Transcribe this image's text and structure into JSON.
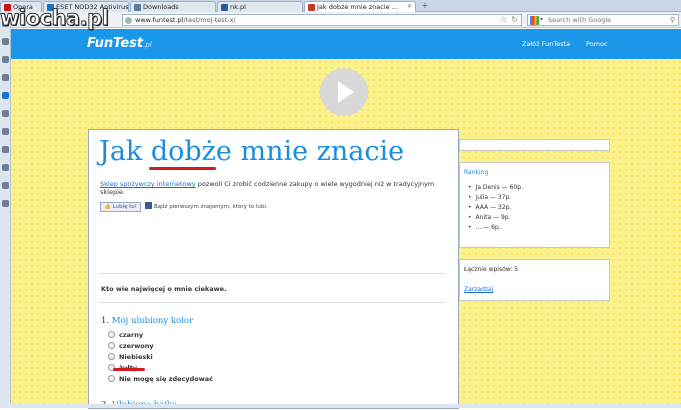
{
  "watermark": "wiocha.pl",
  "tabs": [
    {
      "label": "Opera",
      "fav_color": "#cc0f16"
    },
    {
      "label": "ESET NOD32 Antivirus ...",
      "fav_color": "#1b73c8"
    },
    {
      "label": "Downloads",
      "fav_color": "#5b7da6"
    },
    {
      "label": "nk.pl",
      "fav_color": "#2a5a9a"
    },
    {
      "label": "Jak dobze mnie znacie ...",
      "fav_color": "#c0392b"
    }
  ],
  "address": {
    "host": "www.funtest.pl",
    "path": "/test/moj-test-x/"
  },
  "search": {
    "placeholder": "Search with Google"
  },
  "site": {
    "logo": "FunTest",
    "logo_suffix": ".pl",
    "nav": [
      "Załóż FunTesta",
      "Pomoc"
    ]
  },
  "main": {
    "title": "Jak dobże mnie znacie",
    "ad_link": "Sklep spożywczy internetowy",
    "ad_text": " pozwoli Ci zrobić codzienne zakupy o wiele wygodniej niż w tradycyjnym sklepie.",
    "like_button": "Lubię to!",
    "like_text": "Bądź pierwszym znajomym, który to lubi.",
    "intro": "Kto wie najwięcej o mnie ciekawe.",
    "question1": {
      "number": "1.",
      "text": "Mój ulubiony kolor",
      "options": [
        "czarny",
        "czerwony",
        "Niebieski",
        "żułty",
        "Nie mogę się zdecydować"
      ]
    },
    "question2": {
      "number": "2.",
      "text": "Ulubiona bajka"
    }
  },
  "sidebar": {
    "ranking_title": "Ranking",
    "ranking": [
      "Ja Denis — 60p.",
      "julia — 37p.",
      "AAA — 32p.",
      "Anita — 9p.",
      "... — 6p."
    ],
    "entries": "Łącznie wpisów: 5",
    "manage": "Zarządzaj"
  },
  "colors": {
    "header": "#1a97e8",
    "accent": "#1a8de0",
    "highlight": "#d01c1c",
    "background": "#fbf28e"
  }
}
